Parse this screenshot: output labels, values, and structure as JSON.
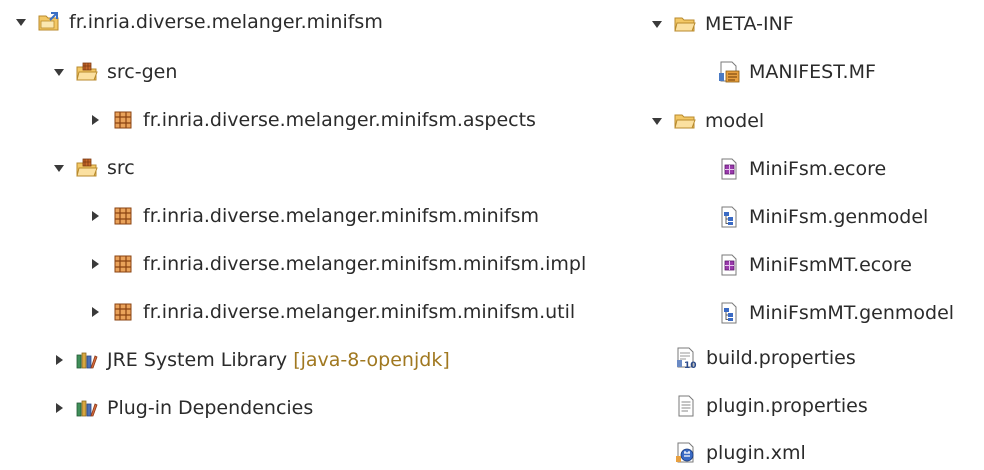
{
  "left": {
    "project": {
      "label": "fr.inria.diverse.melanger.minifsm",
      "twisty": "expanded",
      "icon": "project-icon"
    },
    "src_gen": {
      "label": "src-gen",
      "twisty": "expanded",
      "icon": "source-folder-icon"
    },
    "pkg_aspects": {
      "label": "fr.inria.diverse.melanger.minifsm.aspects",
      "twisty": "collapsed",
      "icon": "package-icon"
    },
    "src": {
      "label": "src",
      "twisty": "expanded",
      "icon": "source-folder-icon"
    },
    "pkg_minifsm": {
      "label": "fr.inria.diverse.melanger.minifsm.minifsm",
      "twisty": "collapsed",
      "icon": "package-icon"
    },
    "pkg_impl": {
      "label": "fr.inria.diverse.melanger.minifsm.minifsm.impl",
      "twisty": "collapsed",
      "icon": "package-icon"
    },
    "pkg_util": {
      "label": "fr.inria.diverse.melanger.minifsm.minifsm.util",
      "twisty": "collapsed",
      "icon": "package-icon"
    },
    "jre": {
      "label": "JRE System Library",
      "decoration": "[java-8-openjdk]",
      "twisty": "collapsed",
      "icon": "library-icon"
    },
    "plugin_deps": {
      "label": "Plug-in Dependencies",
      "twisty": "collapsed",
      "icon": "library-icon"
    }
  },
  "right": {
    "meta_inf": {
      "label": "META-INF",
      "twisty": "expanded",
      "icon": "folder-icon"
    },
    "manifest": {
      "label": "MANIFEST.MF",
      "icon": "manifest-file-icon"
    },
    "model": {
      "label": "model",
      "twisty": "expanded",
      "icon": "folder-icon"
    },
    "minifsm_ecore": {
      "label": "MiniFsm.ecore",
      "icon": "ecore-file-icon"
    },
    "minifsm_genmodel": {
      "label": "MiniFsm.genmodel",
      "icon": "genmodel-file-icon"
    },
    "minifsmmt_ecore": {
      "label": "MiniFsmMT.ecore",
      "icon": "ecore-file-icon"
    },
    "minifsmmt_genmodel": {
      "label": "MiniFsmMT.genmodel",
      "icon": "genmodel-file-icon"
    },
    "build_properties": {
      "label": "build.properties",
      "icon": "build-properties-icon"
    },
    "plugin_properties": {
      "label": "plugin.properties",
      "icon": "properties-file-icon"
    },
    "plugin_xml": {
      "label": "plugin.xml",
      "icon": "plugin-xml-icon"
    }
  },
  "colors": {
    "text": "#2b2b2b",
    "decoration": "#a07820",
    "twisty": "#3a3a3a",
    "folder": "#e8b04a",
    "package": "#b5652a",
    "ecore": "#8a2a9a"
  }
}
